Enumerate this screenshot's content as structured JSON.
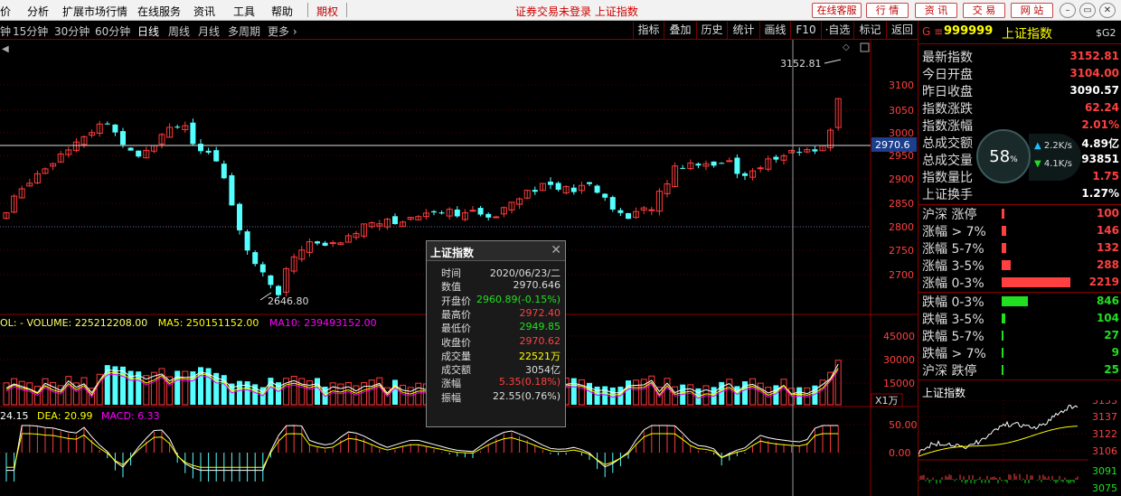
{
  "menu": {
    "items": [
      "价",
      "分析",
      "扩展市场行情",
      "在线服务",
      "资讯",
      "工具",
      "帮助"
    ],
    "qiquan": "期权",
    "title": "证券交易未登录  上证指数",
    "right_buttons": [
      "在线客服",
      "行 情",
      "资 讯",
      "交 易",
      "网 站"
    ],
    "window_buttons": [
      "–",
      "▭",
      "✕"
    ]
  },
  "toolbar": {
    "periods": [
      "钟",
      "15分钟",
      "30分钟",
      "60分钟",
      "日线",
      "周线",
      "月线",
      "多周期",
      "更多 ›"
    ],
    "active_period": "日线",
    "buttons": [
      "指标",
      "叠加",
      "历史",
      "统计",
      "画线",
      "F10",
      "·自选",
      "标记",
      "返回"
    ]
  },
  "main_chart": {
    "price_axis": [
      "3100",
      "3050",
      "3000",
      "2950",
      "2900",
      "2850",
      "2800",
      "2750",
      "2700"
    ],
    "high_label": "3152.81",
    "low_label": "2646.80",
    "crosshair_price": "2970.6",
    "volume_legend": {
      "vol": "OL: -  VOLUME: 225212208.00",
      "ma5": "MA5: 250151152.00",
      "ma10": "MA10: 239493152.00"
    },
    "volume_axis": [
      "45000",
      "30000",
      "15000"
    ],
    "volume_unit": "X1万",
    "macd_legend": {
      "dif": "24.15",
      "dea": "DEA: 20.99",
      "macd": "MACD: 6.33"
    },
    "macd_axis": [
      "50.00",
      "0.00"
    ]
  },
  "popup": {
    "title": "上证指数",
    "close": "✕",
    "rows": [
      {
        "k": "时间",
        "v": "2020/06/23/二",
        "c": "#ddd"
      },
      {
        "k": "数值",
        "v": "2970.646",
        "c": "#ddd"
      },
      {
        "k": "开盘价",
        "v": "2960.89(-0.15%)",
        "c": "#20e020"
      },
      {
        "k": "最高价",
        "v": "2972.40",
        "c": "#ff4040"
      },
      {
        "k": "最低价",
        "v": "2949.85",
        "c": "#20e020"
      },
      {
        "k": "收盘价",
        "v": "2970.62",
        "c": "#ff4040"
      },
      {
        "k": "成交量",
        "v": "22521万",
        "c": "#ffff00"
      },
      {
        "k": "成交额",
        "v": "3054亿",
        "c": "#ddd"
      },
      {
        "k": "涨幅",
        "v": "5.35(0.18%)",
        "c": "#ff4040"
      },
      {
        "k": "振幅",
        "v": "22.55(0.76%)",
        "c": "#ddd"
      }
    ]
  },
  "quote": {
    "g": "G ≡",
    "code": "999999",
    "name": "上证指数",
    "sg": "$G2",
    "rows": [
      {
        "label": "最新指数",
        "value": "3152.81",
        "color": "red"
      },
      {
        "label": "今日开盘",
        "value": "3104.00",
        "color": "red"
      },
      {
        "label": "昨日收盘",
        "value": "3090.57",
        "color": "white"
      },
      {
        "label": "指数涨跌",
        "value": "62.24",
        "color": "red"
      },
      {
        "label": "指数涨幅",
        "value": "2.01%",
        "color": "red"
      },
      {
        "label": "总成交额",
        "value": "4.89亿",
        "color": "white"
      },
      {
        "label": "总成交量",
        "value": "93851",
        "color": "white"
      },
      {
        "label": "指数量比",
        "value": "1.75",
        "color": "red"
      },
      {
        "label": "上证换手",
        "value": "1.27%",
        "color": "white"
      }
    ],
    "gauge": {
      "pct": "58",
      "up": "2.2K/s",
      "down": "4.1K/s"
    }
  },
  "breadth": {
    "up": [
      {
        "label": "沪深 涨停",
        "value": "100",
        "frac": 0.04
      },
      {
        "label": "涨幅 > 7%",
        "value": "146",
        "frac": 0.06
      },
      {
        "label": "涨幅 5-7%",
        "value": "132",
        "frac": 0.06
      },
      {
        "label": "涨幅 3-5%",
        "value": "288",
        "frac": 0.12
      },
      {
        "label": "涨幅 0-3%",
        "value": "2219",
        "frac": 0.95
      }
    ],
    "down": [
      {
        "label": "跌幅 0-3%",
        "value": "846",
        "frac": 0.36
      },
      {
        "label": "跌幅 3-5%",
        "value": "104",
        "frac": 0.05
      },
      {
        "label": "跌幅 5-7%",
        "value": "27",
        "frac": 0.015
      },
      {
        "label": "跌幅 > 7%",
        "value": "9",
        "frac": 0.01
      },
      {
        "label": "沪深 跌停",
        "value": "25",
        "frac": 0.012
      }
    ]
  },
  "mini_chart": {
    "title": "上证指数",
    "axis": [
      "3153",
      "3137",
      "3122",
      "3106",
      "3091",
      "3075"
    ]
  },
  "colors": {
    "up": "#ff3b3b",
    "down": "#54ffff",
    "ma5": "#ffffff",
    "ma10": "#ffff00",
    "ma20": "#ff00ff",
    "frame": "#8b0000"
  }
}
